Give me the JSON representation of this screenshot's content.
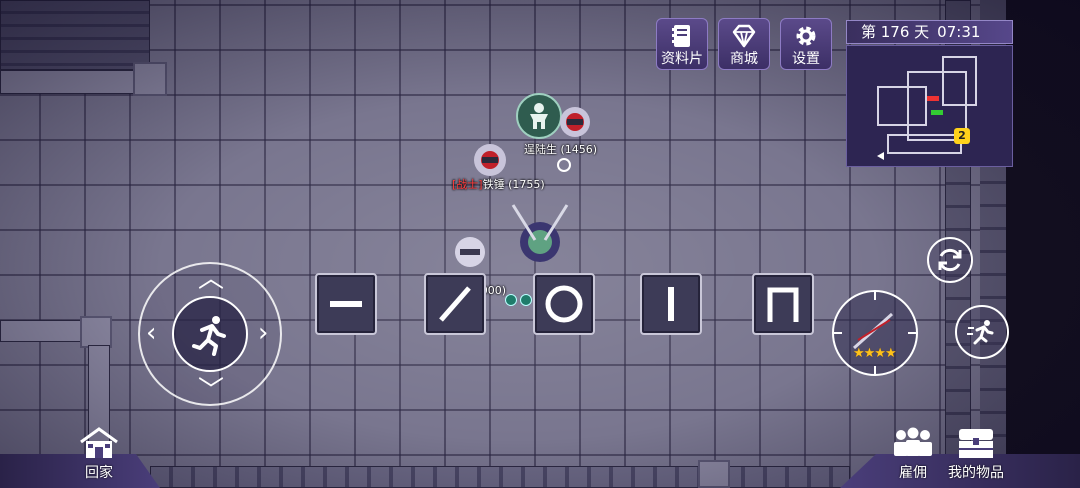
{
  "hud": {
    "day_label": "第 176 天",
    "time": "07:31",
    "minimap_marker": "2"
  },
  "menu": [
    {
      "label": "资料片",
      "icon": "book-icon"
    },
    {
      "label": "商城",
      "icon": "diamond-icon"
    },
    {
      "label": "设置",
      "icon": "gear-icon"
    }
  ],
  "units": [
    {
      "name": "逞陆生 (1456)",
      "tag": ""
    },
    {
      "name": "铁锤 (1755)",
      "tag": "[战士]"
    },
    {
      "name": "姜娜 (1000)",
      "tag": ""
    }
  ],
  "shapes": [
    "horizontal-line",
    "diagonal-line",
    "circle",
    "vertical-line",
    "arch"
  ],
  "controls": {
    "move_icon": "running-person-icon",
    "refresh_icon": "refresh-icon",
    "flee_icon": "flee-icon",
    "weapon_stars": "★★★★"
  },
  "bottom": {
    "home_label": "回家",
    "hire_label": "雇佣",
    "items_label": "我的物品"
  },
  "colors": {
    "accent": "#56478a",
    "tag_red": "#ff3b3b",
    "star": "#ffc21a"
  }
}
